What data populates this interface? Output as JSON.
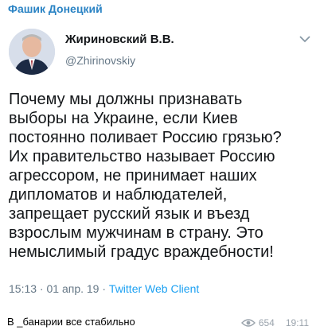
{
  "channel": {
    "name": "Фашик Донецкий"
  },
  "tweet": {
    "author_name": "Жириновский В.В.",
    "author_handle": "@Zhirinovskiy",
    "text": "Почему мы должны признавать\nвыборы на Украине, если Киев\nпостоянно поливает Россию грязью?\nИх правительство называет Россию\nагрессором, не принимает наших\nдипломатов и наблюдателей,\nзапрещает русский язык и въезд\nвзрослым мужчинам в страну. Это\nнемыслимый градус враждебности!",
    "time": "15:13",
    "separator1": " · ",
    "date": "01 апр. 19",
    "separator2": " · ",
    "client": "Twitter Web Client"
  },
  "message": {
    "caption": "В _банарии все стабильно",
    "views": "654",
    "time": "19:11"
  },
  "icons": {
    "chevron": "chevron-down-icon",
    "views": "eye-icon",
    "avatar": "avatar-photo"
  },
  "colors": {
    "channel_name": "#2a83c4",
    "link": "#1da1f2",
    "muted": "#657786"
  }
}
